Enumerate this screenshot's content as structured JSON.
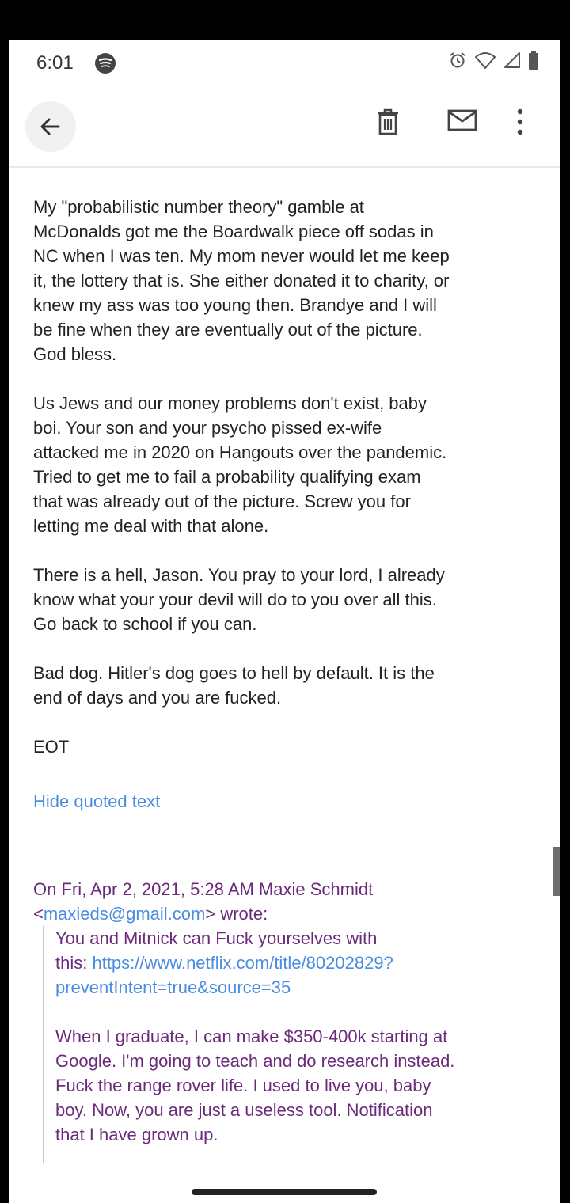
{
  "status_bar": {
    "time": "6:01",
    "icons": [
      "spotify-icon",
      "alarm-icon",
      "wifi-icon",
      "signal-icon",
      "battery-icon"
    ]
  },
  "app_bar": {
    "back_icon": "arrow-back-icon",
    "actions": [
      "trash-icon",
      "mail-icon",
      "more-vert-icon"
    ]
  },
  "message": {
    "paragraphs": [
      [
        "My \"probabilistic number theory\" gamble at",
        "McDonalds got me the Boardwalk piece off sodas in",
        "NC when I was ten. My mom never would let me keep",
        "it, the lottery that is. She either donated it to charity, or",
        "knew my ass was too young then. Brandye and I will",
        "be fine when they are eventually out of the picture.",
        "God bless."
      ],
      [
        "Us Jews and our money problems don't exist, baby",
        "boi. Your son and your psycho pissed ex-wife",
        "attacked me in 2020 on Hangouts over the pandemic.",
        "Tried to get me to fail a probability qualifying exam",
        "that was already out of the picture. Screw you for",
        "letting me deal with that alone."
      ],
      [
        "There is a hell, Jason. You pray to your lord, I already",
        "know what your your devil will do to you over all this.",
        "Go back to school if you can."
      ],
      [
        "Bad dog. Hitler's dog goes to hell by default. It is the",
        "end of days and you are fucked."
      ],
      [
        "EOT"
      ]
    ]
  },
  "hide_quoted_label": "Hide quoted text",
  "quote": {
    "header_line1": "On Fri, Apr 2, 2021, 5:28 AM Maxie Schmidt",
    "header_email_prefix": "<",
    "header_email": "maxieds@gmail.com",
    "header_email_suffix": "> wrote:",
    "p1_line1": "You and Mitnick can Fuck yourselves with",
    "p1_line2_prefix": "this: ",
    "p1_link_part1": "https://www.netflix.com/title/80202829?",
    "p1_link_part2": "preventIntent=true&source=35",
    "p2_lines": [
      "When I graduate, I can make $350-400k starting at",
      "Google. I'm going to teach and do research instead.",
      "Fuck the range rover life. I used to live you, baby",
      "boy. Now, you are just a useless tool. Notification",
      "that I have grown up."
    ]
  },
  "colors": {
    "link": "#4a8de0",
    "quoted_text": "#6b2b7b",
    "body_text": "#222222"
  }
}
